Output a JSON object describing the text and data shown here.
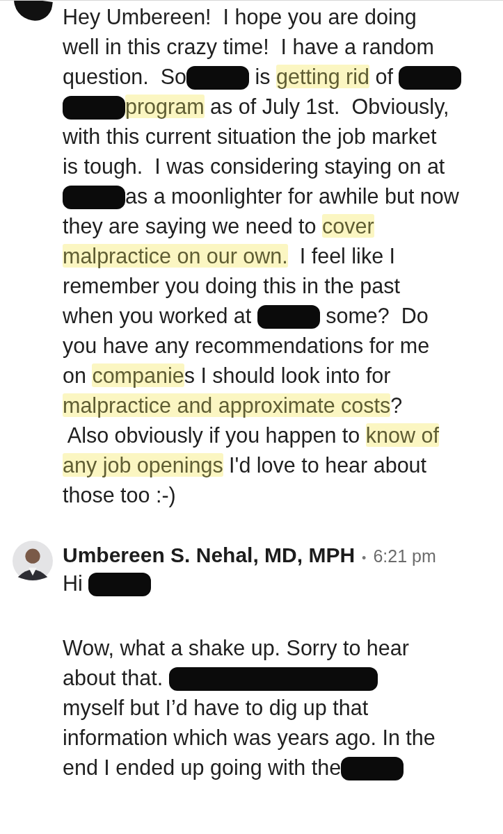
{
  "messages": [
    {
      "avatar_redacted": true,
      "paragraphs": [
        [
          [
            {
              "kind": "plain",
              "text": "Hey Umbereen!  I hope you are doing"
            }
          ],
          [
            {
              "kind": "plain",
              "text": "well in this crazy time!  I have a random"
            }
          ],
          [
            {
              "kind": "plain",
              "text": "question.  So"
            },
            {
              "kind": "redaction"
            },
            {
              "kind": "plain",
              "text": " is "
            },
            {
              "kind": "highlight",
              "text": "getting rid"
            },
            {
              "kind": "plain",
              "text": " of "
            },
            {
              "kind": "redaction"
            }
          ],
          [
            {
              "kind": "redaction"
            },
            {
              "kind": "highlight",
              "text": "program"
            },
            {
              "kind": "plain",
              "text": " as of July 1st.  Obviously,"
            }
          ],
          [
            {
              "kind": "plain",
              "text": "with this current situation the job market"
            }
          ],
          [
            {
              "kind": "plain",
              "text": "is tough.  I was considering staying on at"
            }
          ],
          [
            {
              "kind": "redaction"
            },
            {
              "kind": "plain",
              "text": "as a moonlighter for awhile but now"
            }
          ],
          [
            {
              "kind": "plain",
              "text": "they are saying we need to "
            },
            {
              "kind": "highlight",
              "text": "cover"
            }
          ],
          [
            {
              "kind": "highlight",
              "text": "malpractice on our own."
            },
            {
              "kind": "plain",
              "text": "  I feel like I"
            }
          ],
          [
            {
              "kind": "plain",
              "text": "remember you doing this in the past"
            }
          ],
          [
            {
              "kind": "plain",
              "text": "when you worked at "
            },
            {
              "kind": "redaction"
            },
            {
              "kind": "plain",
              "text": " some?  Do"
            }
          ],
          [
            {
              "kind": "plain",
              "text": "you have any recommendations for me"
            }
          ],
          [
            {
              "kind": "plain",
              "text": "on "
            },
            {
              "kind": "highlight",
              "text": "companie"
            },
            {
              "kind": "plain",
              "text": "s I should look into for"
            }
          ],
          [
            {
              "kind": "highlight",
              "text": "malpractice and approximate costs"
            },
            {
              "kind": "plain",
              "text": "?"
            }
          ],
          [
            {
              "kind": "plain",
              "text": " Also obviously if you happen to "
            },
            {
              "kind": "highlight",
              "text": "know of"
            }
          ],
          [
            {
              "kind": "highlight",
              "text": "any job openings"
            },
            {
              "kind": "plain",
              "text": " I'd love to hear about"
            }
          ],
          [
            {
              "kind": "plain",
              "text": "those too :-)"
            }
          ]
        ]
      ]
    },
    {
      "avatar_redacted": false,
      "sender": "Umbereen S. Nehal, MD, MPH",
      "separator": "•",
      "time": "6:21 pm",
      "paragraphs": [
        [
          [
            {
              "kind": "plain",
              "text": "Hi "
            },
            {
              "kind": "redaction"
            }
          ]
        ],
        [
          [
            {
              "kind": "plain",
              "text": "Wow, what a shake up. Sorry to hear"
            }
          ],
          [
            {
              "kind": "plain",
              "text": "about that. "
            },
            {
              "kind": "scribble"
            }
          ],
          [
            {
              "kind": "plain",
              "text": "myself but I’d have to dig up that"
            }
          ],
          [
            {
              "kind": "plain",
              "text": "information which was years ago. In the"
            }
          ],
          [
            {
              "kind": "plain",
              "text": "end I ended up going with the"
            },
            {
              "kind": "redaction"
            }
          ]
        ]
      ]
    }
  ]
}
